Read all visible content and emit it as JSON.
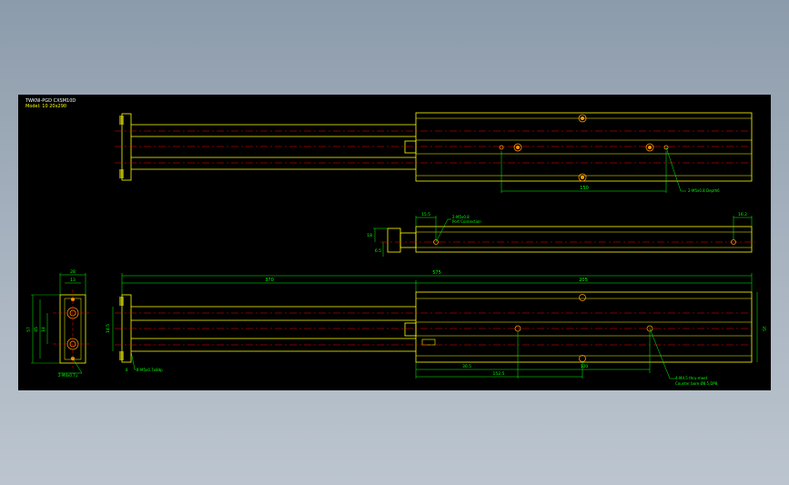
{
  "title_block": {
    "line1": "TWKNI-PGD CXSM10D",
    "line2": "Model: 10 20x290"
  },
  "dimensions": {
    "top_view": {
      "spacing": "150",
      "hole_note": "2-M5x0.8 Depth6"
    },
    "side_view": {
      "left_w": "15.5",
      "right_w": "16.2",
      "port_note": "2-M5x0.8",
      "port_note2": "Port Connection",
      "h1": "18",
      "h2": "6.5"
    },
    "front_view": {
      "overall": "575",
      "left_len": "370",
      "right_len": "205",
      "height": "35",
      "height_left": "14.5",
      "depth1": "30.5",
      "depth2": "152.5",
      "spacing": "120",
      "left_note": "2-M5x0.7x8dp",
      "hole_note": "4-M4.5 thru-meet",
      "hole_note2": "Counter bore Ø8.5 DP8"
    },
    "end_view": {
      "width": "28",
      "inner": "13",
      "height": "57",
      "inner_h1": "45",
      "inner_h2": "14",
      "tap_note": "2-M4x0.7↓",
      "depth": "8"
    }
  },
  "colors": {
    "background": "#000000",
    "outline": "#ffff00",
    "centerline": "#ff0000",
    "dimension": "#00ff00",
    "hole": "#ff9900"
  }
}
